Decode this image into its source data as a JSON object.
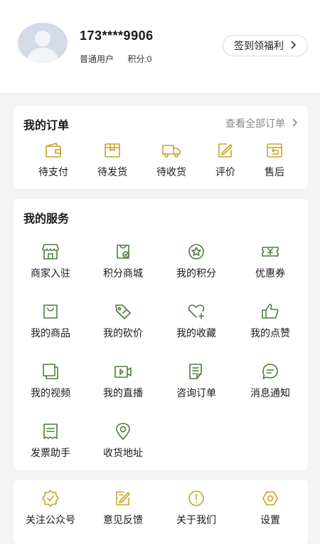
{
  "user": {
    "phone": "173****9906",
    "level": "普通用户",
    "points_label": "积分:0",
    "signin_label": "签到领福利"
  },
  "orders": {
    "title": "我的订单",
    "view_all": "查看全部订单",
    "items": [
      {
        "label": "待支付",
        "icon": "wallet-icon"
      },
      {
        "label": "待发货",
        "icon": "box-icon"
      },
      {
        "label": "待收货",
        "icon": "truck-icon"
      },
      {
        "label": "评价",
        "icon": "edit-icon"
      },
      {
        "label": "售后",
        "icon": "return-icon"
      }
    ]
  },
  "services": {
    "title": "我的服务",
    "items": [
      {
        "label": "商家入驻",
        "icon": "store-icon"
      },
      {
        "label": "积分商城",
        "icon": "points-bag-icon"
      },
      {
        "label": "我的积分",
        "icon": "star-coin-icon"
      },
      {
        "label": "优惠券",
        "icon": "coupon-icon"
      },
      {
        "label": "我的商品",
        "icon": "bag-icon"
      },
      {
        "label": "我的砍价",
        "icon": "price-tag-icon"
      },
      {
        "label": "我的收藏",
        "icon": "heart-plus-icon"
      },
      {
        "label": "我的点赞",
        "icon": "thumbs-up-icon"
      },
      {
        "label": "我的视频",
        "icon": "video-layers-icon"
      },
      {
        "label": "我的直播",
        "icon": "live-camera-icon"
      },
      {
        "label": "咨询订单",
        "icon": "document-icon"
      },
      {
        "label": "消息通知",
        "icon": "message-icon"
      },
      {
        "label": "发票助手",
        "icon": "invoice-icon"
      },
      {
        "label": "收货地址",
        "icon": "location-pin-icon"
      }
    ]
  },
  "more": {
    "items": [
      {
        "label": "关注公众号",
        "icon": "badge-icon"
      },
      {
        "label": "意见反馈",
        "icon": "feedback-icon"
      },
      {
        "label": "关于我们",
        "icon": "info-icon"
      },
      {
        "label": "设置",
        "icon": "settings-icon"
      }
    ]
  },
  "colors": {
    "gold_accent": "#c9a227",
    "green_accent": "#4f7c3f",
    "background": "#f4f4f4"
  }
}
